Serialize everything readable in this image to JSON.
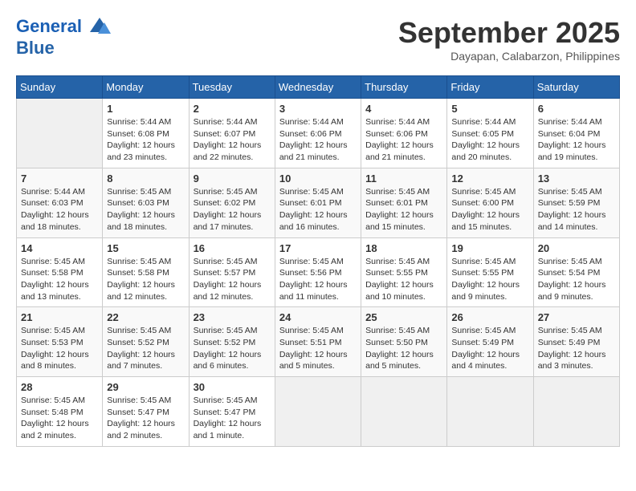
{
  "header": {
    "logo_line1": "General",
    "logo_line2": "Blue",
    "month": "September 2025",
    "location": "Dayapan, Calabarzon, Philippines"
  },
  "weekdays": [
    "Sunday",
    "Monday",
    "Tuesday",
    "Wednesday",
    "Thursday",
    "Friday",
    "Saturday"
  ],
  "weeks": [
    [
      {
        "day": "",
        "info": ""
      },
      {
        "day": "1",
        "info": "Sunrise: 5:44 AM\nSunset: 6:08 PM\nDaylight: 12 hours\nand 23 minutes."
      },
      {
        "day": "2",
        "info": "Sunrise: 5:44 AM\nSunset: 6:07 PM\nDaylight: 12 hours\nand 22 minutes."
      },
      {
        "day": "3",
        "info": "Sunrise: 5:44 AM\nSunset: 6:06 PM\nDaylight: 12 hours\nand 21 minutes."
      },
      {
        "day": "4",
        "info": "Sunrise: 5:44 AM\nSunset: 6:06 PM\nDaylight: 12 hours\nand 21 minutes."
      },
      {
        "day": "5",
        "info": "Sunrise: 5:44 AM\nSunset: 6:05 PM\nDaylight: 12 hours\nand 20 minutes."
      },
      {
        "day": "6",
        "info": "Sunrise: 5:44 AM\nSunset: 6:04 PM\nDaylight: 12 hours\nand 19 minutes."
      }
    ],
    [
      {
        "day": "7",
        "info": "Sunrise: 5:44 AM\nSunset: 6:03 PM\nDaylight: 12 hours\nand 18 minutes."
      },
      {
        "day": "8",
        "info": "Sunrise: 5:45 AM\nSunset: 6:03 PM\nDaylight: 12 hours\nand 18 minutes."
      },
      {
        "day": "9",
        "info": "Sunrise: 5:45 AM\nSunset: 6:02 PM\nDaylight: 12 hours\nand 17 minutes."
      },
      {
        "day": "10",
        "info": "Sunrise: 5:45 AM\nSunset: 6:01 PM\nDaylight: 12 hours\nand 16 minutes."
      },
      {
        "day": "11",
        "info": "Sunrise: 5:45 AM\nSunset: 6:01 PM\nDaylight: 12 hours\nand 15 minutes."
      },
      {
        "day": "12",
        "info": "Sunrise: 5:45 AM\nSunset: 6:00 PM\nDaylight: 12 hours\nand 15 minutes."
      },
      {
        "day": "13",
        "info": "Sunrise: 5:45 AM\nSunset: 5:59 PM\nDaylight: 12 hours\nand 14 minutes."
      }
    ],
    [
      {
        "day": "14",
        "info": "Sunrise: 5:45 AM\nSunset: 5:58 PM\nDaylight: 12 hours\nand 13 minutes."
      },
      {
        "day": "15",
        "info": "Sunrise: 5:45 AM\nSunset: 5:58 PM\nDaylight: 12 hours\nand 12 minutes."
      },
      {
        "day": "16",
        "info": "Sunrise: 5:45 AM\nSunset: 5:57 PM\nDaylight: 12 hours\nand 12 minutes."
      },
      {
        "day": "17",
        "info": "Sunrise: 5:45 AM\nSunset: 5:56 PM\nDaylight: 12 hours\nand 11 minutes."
      },
      {
        "day": "18",
        "info": "Sunrise: 5:45 AM\nSunset: 5:55 PM\nDaylight: 12 hours\nand 10 minutes."
      },
      {
        "day": "19",
        "info": "Sunrise: 5:45 AM\nSunset: 5:55 PM\nDaylight: 12 hours\nand 9 minutes."
      },
      {
        "day": "20",
        "info": "Sunrise: 5:45 AM\nSunset: 5:54 PM\nDaylight: 12 hours\nand 9 minutes."
      }
    ],
    [
      {
        "day": "21",
        "info": "Sunrise: 5:45 AM\nSunset: 5:53 PM\nDaylight: 12 hours\nand 8 minutes."
      },
      {
        "day": "22",
        "info": "Sunrise: 5:45 AM\nSunset: 5:52 PM\nDaylight: 12 hours\nand 7 minutes."
      },
      {
        "day": "23",
        "info": "Sunrise: 5:45 AM\nSunset: 5:52 PM\nDaylight: 12 hours\nand 6 minutes."
      },
      {
        "day": "24",
        "info": "Sunrise: 5:45 AM\nSunset: 5:51 PM\nDaylight: 12 hours\nand 5 minutes."
      },
      {
        "day": "25",
        "info": "Sunrise: 5:45 AM\nSunset: 5:50 PM\nDaylight: 12 hours\nand 5 minutes."
      },
      {
        "day": "26",
        "info": "Sunrise: 5:45 AM\nSunset: 5:49 PM\nDaylight: 12 hours\nand 4 minutes."
      },
      {
        "day": "27",
        "info": "Sunrise: 5:45 AM\nSunset: 5:49 PM\nDaylight: 12 hours\nand 3 minutes."
      }
    ],
    [
      {
        "day": "28",
        "info": "Sunrise: 5:45 AM\nSunset: 5:48 PM\nDaylight: 12 hours\nand 2 minutes."
      },
      {
        "day": "29",
        "info": "Sunrise: 5:45 AM\nSunset: 5:47 PM\nDaylight: 12 hours\nand 2 minutes."
      },
      {
        "day": "30",
        "info": "Sunrise: 5:45 AM\nSunset: 5:47 PM\nDaylight: 12 hours\nand 1 minute."
      },
      {
        "day": "",
        "info": ""
      },
      {
        "day": "",
        "info": ""
      },
      {
        "day": "",
        "info": ""
      },
      {
        "day": "",
        "info": ""
      }
    ]
  ]
}
